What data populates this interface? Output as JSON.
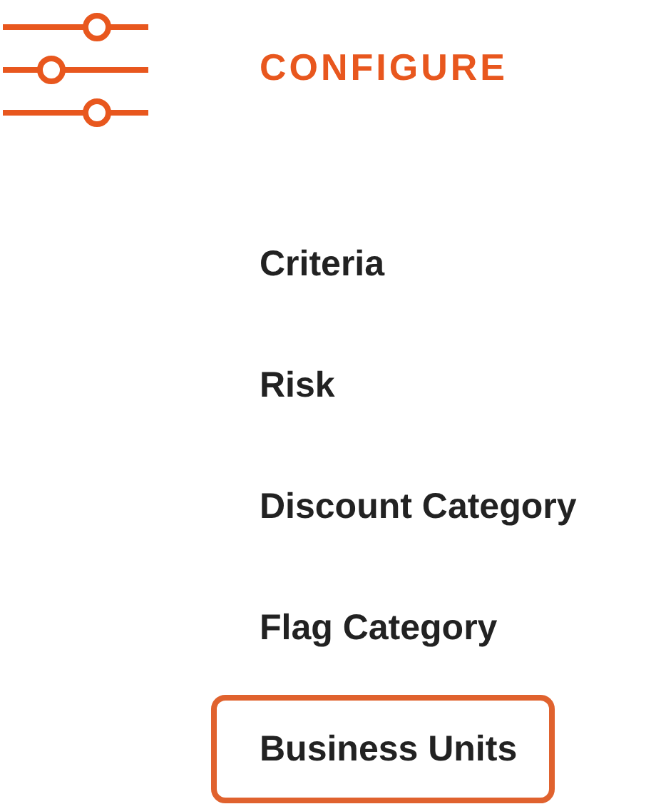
{
  "header": {
    "title": "CONFIGURE"
  },
  "menu": [
    {
      "label": "Criteria",
      "selected": false
    },
    {
      "label": "Risk",
      "selected": false
    },
    {
      "label": "Discount Category",
      "selected": false
    },
    {
      "label": "Flag Category",
      "selected": false
    },
    {
      "label": "Business Units",
      "selected": true
    }
  ]
}
